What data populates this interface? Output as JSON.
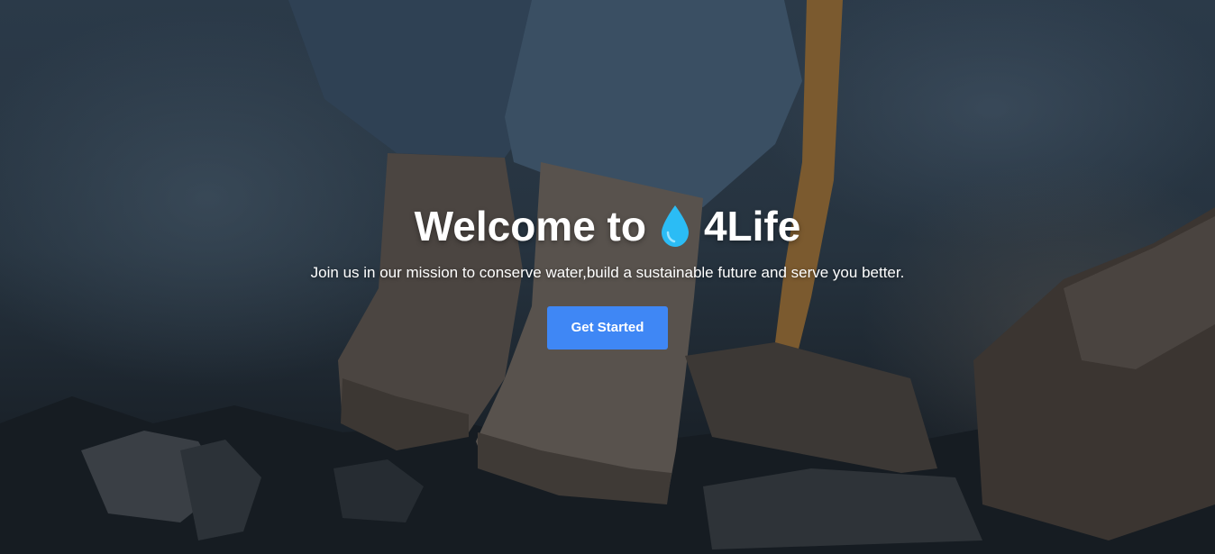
{
  "hero": {
    "title_prefix": "Welcome to",
    "title_suffix": "4Life",
    "logo_icon": "water-drop-icon",
    "subtitle": "Join us in our mission to conserve water,build a sustainable future and serve you better.",
    "cta_label": "Get Started",
    "background_image": "hiking-boot-shovel-rocky-ground-photo"
  },
  "colors": {
    "accent": "#3f87f5",
    "drop": "#2bbcf5",
    "text": "#ffffff"
  }
}
